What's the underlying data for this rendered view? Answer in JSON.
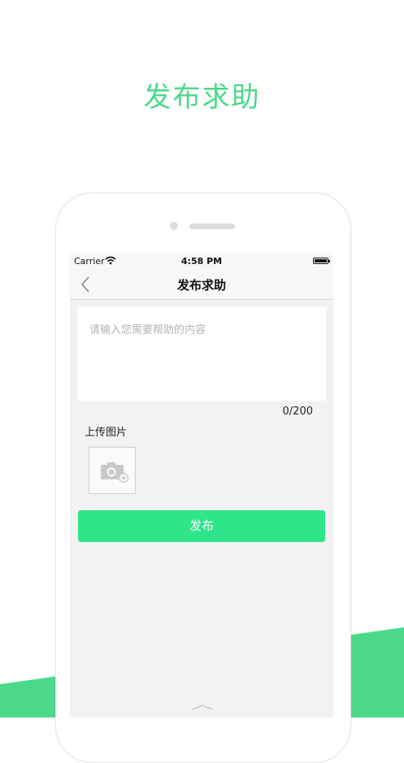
{
  "hero": {
    "title": "发布求助"
  },
  "statusbar": {
    "carrier": "Carrier",
    "time": "4:58 PM"
  },
  "navbar": {
    "title": "发布求助",
    "back_icon": "chevron-left-icon"
  },
  "form": {
    "placeholder": "请输入您需要帮助的内容",
    "counter": "0/200",
    "upload_label": "上传图片",
    "upload_icon": "camera-add-icon",
    "publish_label": "发布"
  },
  "colors": {
    "accent": "#2fe58a",
    "hero_text": "#4cd88a",
    "wave": "#4cd88a",
    "screen_bg": "#f2f2f2"
  }
}
